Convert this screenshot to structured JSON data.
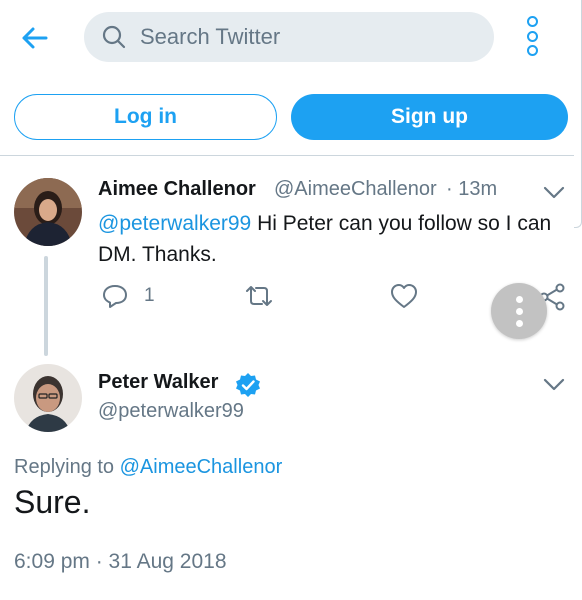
{
  "search": {
    "placeholder": "Search Twitter"
  },
  "auth": {
    "login_label": "Log in",
    "signup_label": "Sign up"
  },
  "colors": {
    "accent": "#1da1f2",
    "muted": "#657786",
    "link": "#1b95e0",
    "fab": "#c2c2c2"
  },
  "icons": [
    "back-arrow-icon",
    "search-icon",
    "more-options-icon",
    "chevron-down-icon",
    "reply-icon",
    "retweet-icon",
    "like-icon",
    "share-icon",
    "verified-icon",
    "fab-more-icon"
  ],
  "tweet1": {
    "author_name": "Aimee Challenor",
    "author_handle": "@AimeeChallenor",
    "time": "· 13m",
    "text_mention": "@peterwalker99",
    "text_body": " Hi Peter can you follow so I can DM. Thanks.",
    "reply_count": "1"
  },
  "tweet2": {
    "author_name": "Peter Walker",
    "author_handle": "@peterwalker99",
    "replying_prefix": "Replying to ",
    "replying_to": "@AimeeChallenor",
    "text": "Sure.",
    "timestamp": "6:09 pm · 31 Aug 2018"
  }
}
